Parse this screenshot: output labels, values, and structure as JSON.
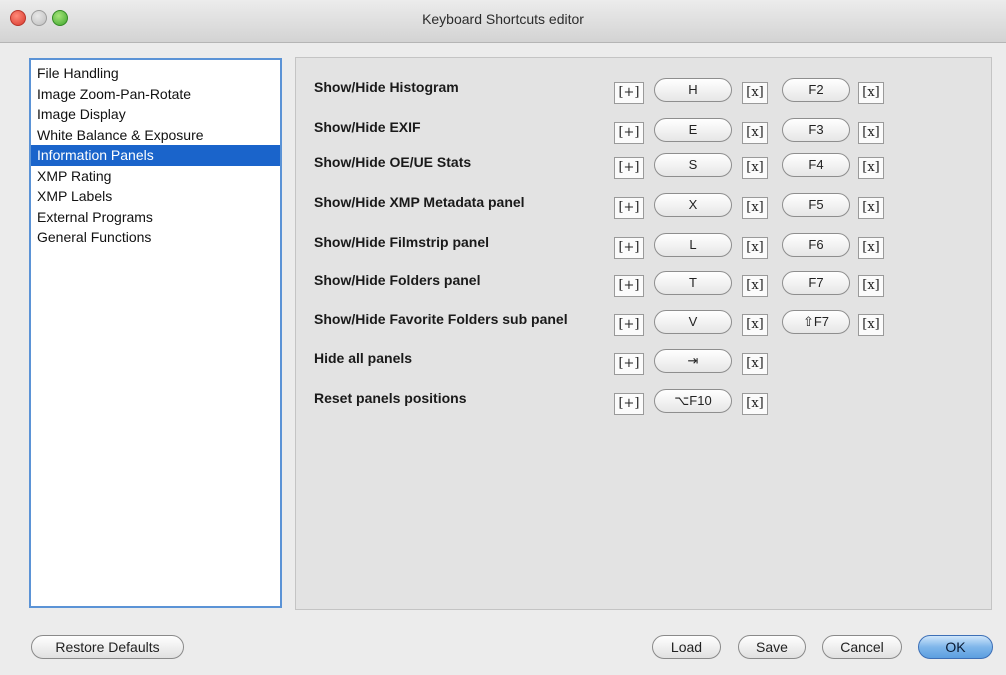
{
  "window": {
    "title": "Keyboard Shortcuts editor"
  },
  "categories": [
    {
      "label": "File Handling",
      "selected": false
    },
    {
      "label": "Image Zoom-Pan-Rotate",
      "selected": false
    },
    {
      "label": "Image Display",
      "selected": false
    },
    {
      "label": "White Balance & Exposure",
      "selected": false
    },
    {
      "label": "Information Panels",
      "selected": true
    },
    {
      "label": "XMP Rating",
      "selected": false
    },
    {
      "label": "XMP Labels",
      "selected": false
    },
    {
      "label": "External Programs",
      "selected": false
    },
    {
      "label": "General Functions",
      "selected": false
    }
  ],
  "shortcut_controls": {
    "add_label": "[+]",
    "clear_label": "[x]"
  },
  "shortcuts": [
    {
      "label": "Show/Hide Histogram",
      "key1": "H",
      "key2": "F2"
    },
    {
      "label": "Show/Hide EXIF",
      "key1": "E",
      "key2": "F3"
    },
    {
      "label": "Show/Hide OE/UE Stats",
      "key1": "S",
      "key2": "F4"
    },
    {
      "label": "Show/Hide XMP Metadata panel",
      "key1": "X",
      "key2": "F5"
    },
    {
      "label": "Show/Hide Filmstrip panel",
      "key1": "L",
      "key2": "F6"
    },
    {
      "label": "Show/Hide Folders panel",
      "key1": "T",
      "key2": "F7"
    },
    {
      "label": "Show/Hide Favorite Folders sub panel",
      "key1": "V",
      "key2": "⇧F7"
    },
    {
      "label": "Hide all panels",
      "key1": "⇥",
      "key2": null
    },
    {
      "label": "Reset panels positions",
      "key1": "⌥F10",
      "key2": null
    }
  ],
  "footer": {
    "restore_defaults": "Restore Defaults",
    "load": "Load",
    "save": "Save",
    "cancel": "Cancel",
    "ok": "OK"
  },
  "colors": {
    "selection": "#1a64cb",
    "list_border": "#5b93d6",
    "ok_button": "#7fb6ea"
  }
}
